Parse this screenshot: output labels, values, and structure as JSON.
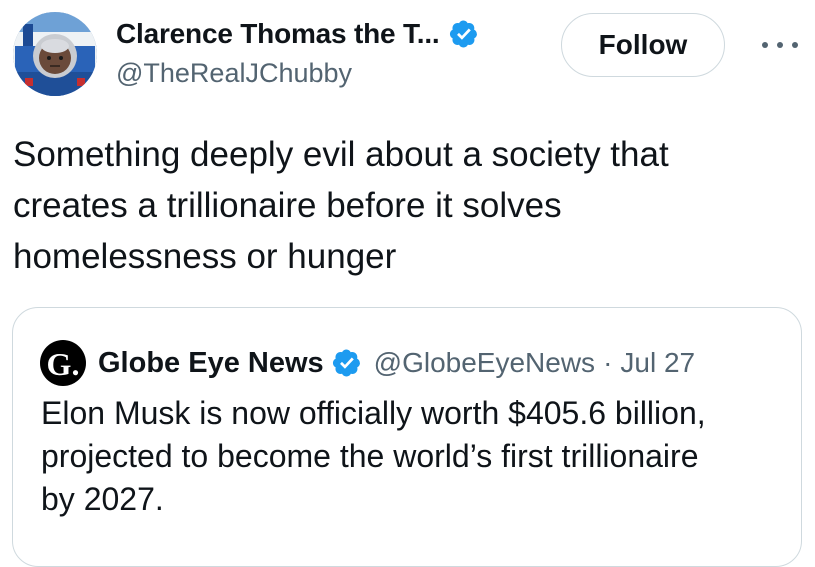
{
  "author": {
    "display_name": "Clarence Thomas the T...",
    "handle": "@TheRealJChubby",
    "verified": true,
    "avatar": "avatar-thomas-tank-engine"
  },
  "actions": {
    "follow_label": "Follow",
    "more_icon": "more-horizontal-icon"
  },
  "tweet": {
    "text_lines": [
      "Something deeply evil about a society that",
      "creates a trillionaire before it solves",
      "homelessness or hunger"
    ]
  },
  "quote": {
    "logo_letter": "G.",
    "display_name": "Globe Eye News",
    "verified": true,
    "handle": "@GlobeEyeNews",
    "separator": "·",
    "date": "Jul 27",
    "text_lines": [
      "Elon Musk is now officially worth $405.6 billion,",
      "projected to become the world’s first trillionaire",
      "by 2027."
    ]
  },
  "colors": {
    "text_primary": "#0f1419",
    "text_secondary": "#536471",
    "verified_blue": "#1d9bf0",
    "border": "#cfd9de"
  }
}
